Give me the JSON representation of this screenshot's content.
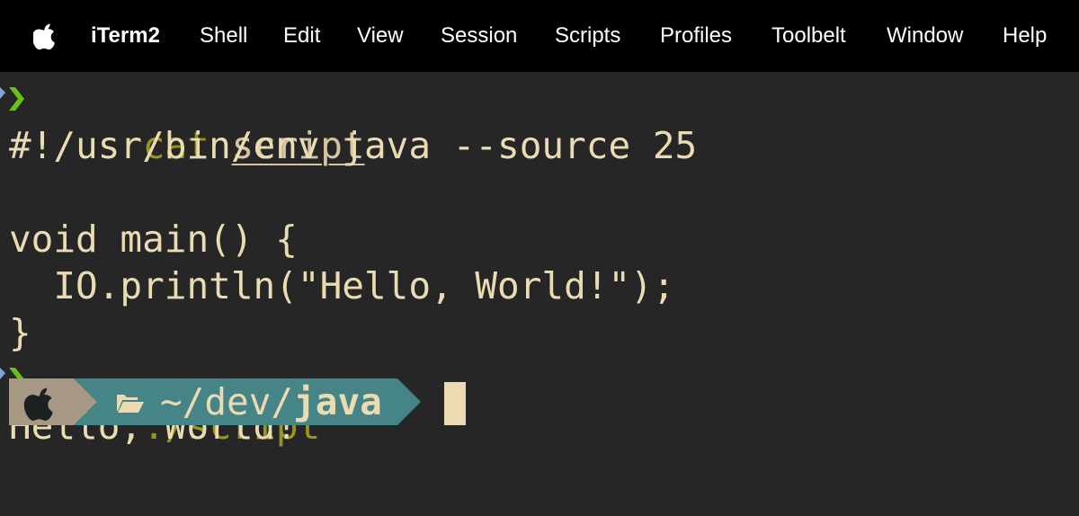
{
  "menubar": {
    "app_name": "iTerm2",
    "items": [
      "Shell",
      "Edit",
      "View",
      "Session",
      "Scripts",
      "Profiles",
      "Toolbelt",
      "Window",
      "Help"
    ]
  },
  "terminal": {
    "cmd1": {
      "command": "cat",
      "argument": "script"
    },
    "output1": [
      "#!/usr/bin/env java --source 25",
      "",
      "void main() {",
      "  IO.println(\"Hello, World!\");",
      "}"
    ],
    "cmd2": {
      "command": "./script"
    },
    "output2": "Hello, World!"
  },
  "prompt": {
    "path_prefix": "~/dev/",
    "path_leaf": "java",
    "icons": {
      "os": "apple-icon",
      "folder": "folder-open-icon",
      "prompt": "chevron-right-icon"
    }
  },
  "colors": {
    "terminal_bg": "#262626",
    "text": "#ebdbb2",
    "command": "#98971a",
    "prompt_green": "#6abf1a",
    "prompt_blue": "#83a5d6",
    "segment_os": "#a89984",
    "segment_dir": "#458588"
  }
}
